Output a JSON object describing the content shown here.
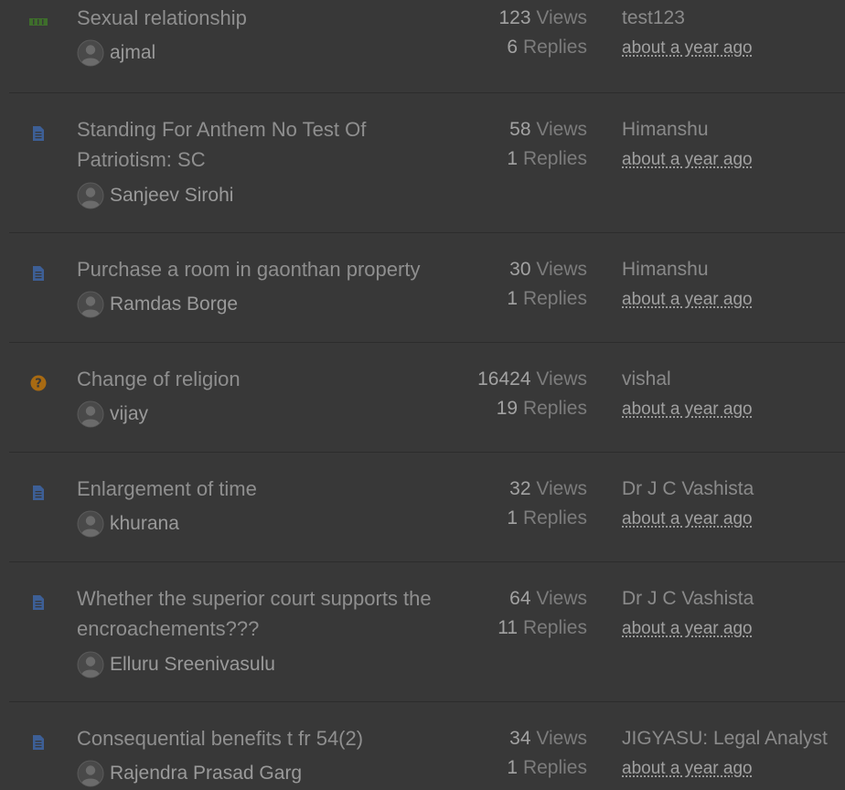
{
  "colors": {
    "background": "#383838",
    "divider": "#2c2c2c",
    "title_text": "#8f8f8f",
    "doc_icon": "#3d5f96",
    "question_icon": "#a86a12",
    "poll_icon": "#3e6e2b"
  },
  "views_label": "Views",
  "replies_label": "Replies",
  "threads": [
    {
      "icon": "poll-icon",
      "title": "Sexual relationship",
      "author": "ajmal",
      "views": "123",
      "replies": "6",
      "last_user": "test123",
      "last_time": "about a year ago"
    },
    {
      "icon": "document-icon",
      "title": "Standing For Anthem No Test Of Patriotism: SC",
      "author": "Sanjeev Sirohi",
      "views": "58",
      "replies": "1",
      "last_user": "Himanshu",
      "last_time": "about a year ago"
    },
    {
      "icon": "document-icon",
      "title": "Purchase a room in gaonthan property",
      "author": "Ramdas Borge",
      "views": "30",
      "replies": "1",
      "last_user": "Himanshu",
      "last_time": "about a year ago"
    },
    {
      "icon": "question-icon",
      "title": "Change of religion",
      "author": "vijay",
      "views": "16424",
      "replies": "19",
      "last_user": "vishal",
      "last_time": "about a year ago"
    },
    {
      "icon": "document-icon",
      "title": "Enlargement of time",
      "author": "khurana",
      "views": "32",
      "replies": "1",
      "last_user": "Dr J C Vashista",
      "last_time": "about a year ago"
    },
    {
      "icon": "document-icon",
      "title": "Whether the superior court supports the encroachements???",
      "author": "Elluru Sreenivasulu",
      "views": "64",
      "replies": "11",
      "last_user": "Dr J C Vashista",
      "last_time": "about a year ago"
    },
    {
      "icon": "document-icon",
      "title": "Consequential benefits t fr 54(2)",
      "author": "Rajendra Prasad Garg",
      "views": "34",
      "replies": "1",
      "last_user": "JIGYASU: Legal Analyst",
      "last_time": "about a year ago"
    }
  ]
}
